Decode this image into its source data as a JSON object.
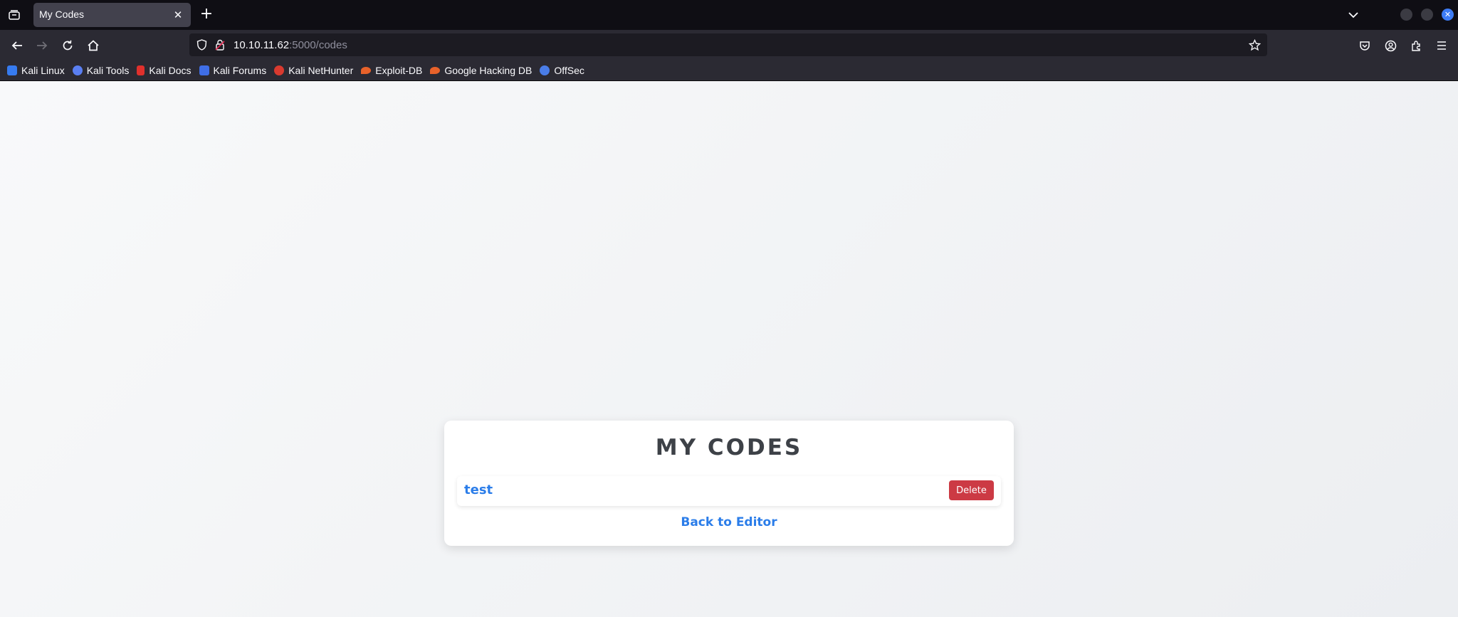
{
  "browser": {
    "tab": {
      "title": "My Codes",
      "close_glyph": "✕"
    },
    "new_tab_glyph": "+",
    "url": {
      "host": "10.10.11.62",
      "rest": ":5000/codes"
    },
    "bookmarks": [
      {
        "label": "Kali Linux",
        "icon_color": "#367bf0"
      },
      {
        "label": "Kali Tools",
        "icon_color": "#5a7ff2"
      },
      {
        "label": "Kali Docs",
        "icon_color": "#e0302c"
      },
      {
        "label": "Kali Forums",
        "icon_color": "#3f6ee6"
      },
      {
        "label": "Kali NetHunter",
        "icon_color": "#d93a2f"
      },
      {
        "label": "Exploit-DB",
        "icon_color": "#e8622a"
      },
      {
        "label": "Google Hacking DB",
        "icon_color": "#e8622a"
      },
      {
        "label": "OffSec",
        "icon_color": "#4a7de8"
      }
    ]
  },
  "page": {
    "title": "MY CODES",
    "codes": [
      {
        "name": "test",
        "delete_label": "Delete"
      }
    ],
    "back_link": "Back to Editor"
  },
  "colors": {
    "accent_link": "#2b7de9",
    "delete_button": "#cc3a44"
  }
}
